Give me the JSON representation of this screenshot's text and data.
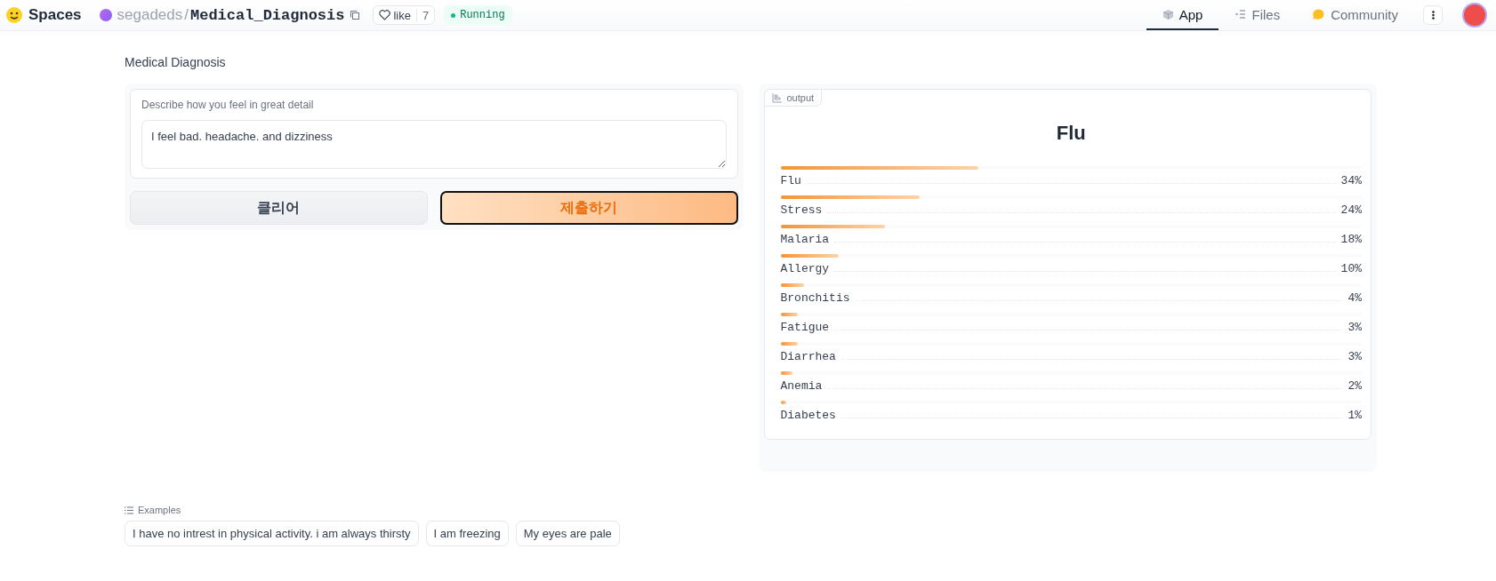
{
  "header": {
    "brand": "Spaces",
    "owner": "segadeds",
    "separator": "/",
    "repo": "Medical_Diagnosis",
    "like": {
      "label": "like",
      "count": "7"
    },
    "status": "Running",
    "tabs": [
      {
        "label": "App",
        "kind": "app",
        "selected": true
      },
      {
        "label": "Files",
        "kind": "files",
        "selected": false
      },
      {
        "label": "Community",
        "kind": "community",
        "selected": false
      }
    ]
  },
  "title": "Medical Diagnosis",
  "input": {
    "label": "Describe how you feel in great detail",
    "value": "I feel bad. headache. and dizziness"
  },
  "buttons": [
    {
      "label": "클리어",
      "kind": "secondary"
    },
    {
      "label": "제출하기",
      "kind": "primary"
    }
  ],
  "output": {
    "label": "output",
    "top_label": "Flu",
    "confidences": [
      {
        "label": "Flu",
        "reading": "34%",
        "level": 0.34
      },
      {
        "label": "Stress",
        "reading": "24%",
        "level": 0.24
      },
      {
        "label": "Malaria",
        "reading": "18%",
        "level": 0.18
      },
      {
        "label": "Allergy",
        "reading": "10%",
        "level": 0.1
      },
      {
        "label": "Bronchitis",
        "reading": "4%",
        "level": 0.04
      },
      {
        "label": "Fatigue",
        "reading": "3%",
        "level": 0.03
      },
      {
        "label": "Diarrhea",
        "reading": "3%",
        "level": 0.03
      },
      {
        "label": "Anemia",
        "reading": "2%",
        "level": 0.02
      },
      {
        "label": "Diabetes",
        "reading": "1%",
        "level": 0.01
      }
    ]
  },
  "examples": {
    "label": "Examples",
    "items": [
      "I have no intrest in physical activity. i am always thirsty",
      "I am freezing",
      "My eyes are pale"
    ]
  }
}
